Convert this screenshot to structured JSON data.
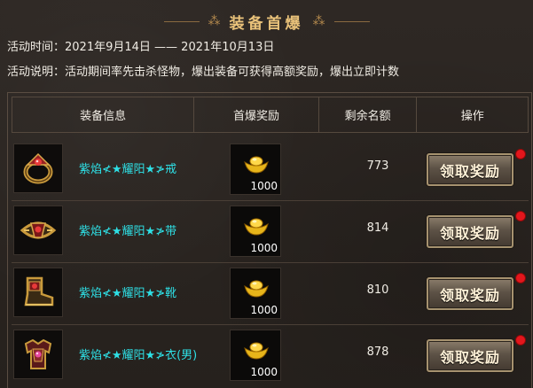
{
  "header": {
    "title": "装备首爆",
    "ornament": "⁂"
  },
  "activity": {
    "time_label": "活动时间：",
    "time_value": "2021年9月14日 —— 2021年10月13日",
    "desc_label": "活动说明：",
    "desc_value": "活动期间率先击杀怪物，爆出装备可获得高额奖励，爆出立即计数"
  },
  "table": {
    "columns": [
      "装备信息",
      "首爆奖励",
      "剩余名额",
      "操作"
    ],
    "rows": [
      {
        "name": "紫焰≮★耀阳★≯戒",
        "reward_amount": "1000",
        "remaining": "773",
        "action": "领取奖励",
        "icon": "ring-icon"
      },
      {
        "name": "紫焰≮★耀阳★≯带",
        "reward_amount": "1000",
        "remaining": "814",
        "action": "领取奖励",
        "icon": "belt-icon"
      },
      {
        "name": "紫焰≮★耀阳★≯靴",
        "reward_amount": "1000",
        "remaining": "810",
        "action": "领取奖励",
        "icon": "boots-icon"
      },
      {
        "name": "紫焰≮★耀阳★≯衣(男)",
        "reward_amount": "1000",
        "remaining": "878",
        "action": "领取奖励",
        "icon": "armor-icon"
      }
    ]
  },
  "colors": {
    "equip_name": "#2ee0e6",
    "title": "#e9c27a",
    "notification_dot": "#e3161c"
  }
}
